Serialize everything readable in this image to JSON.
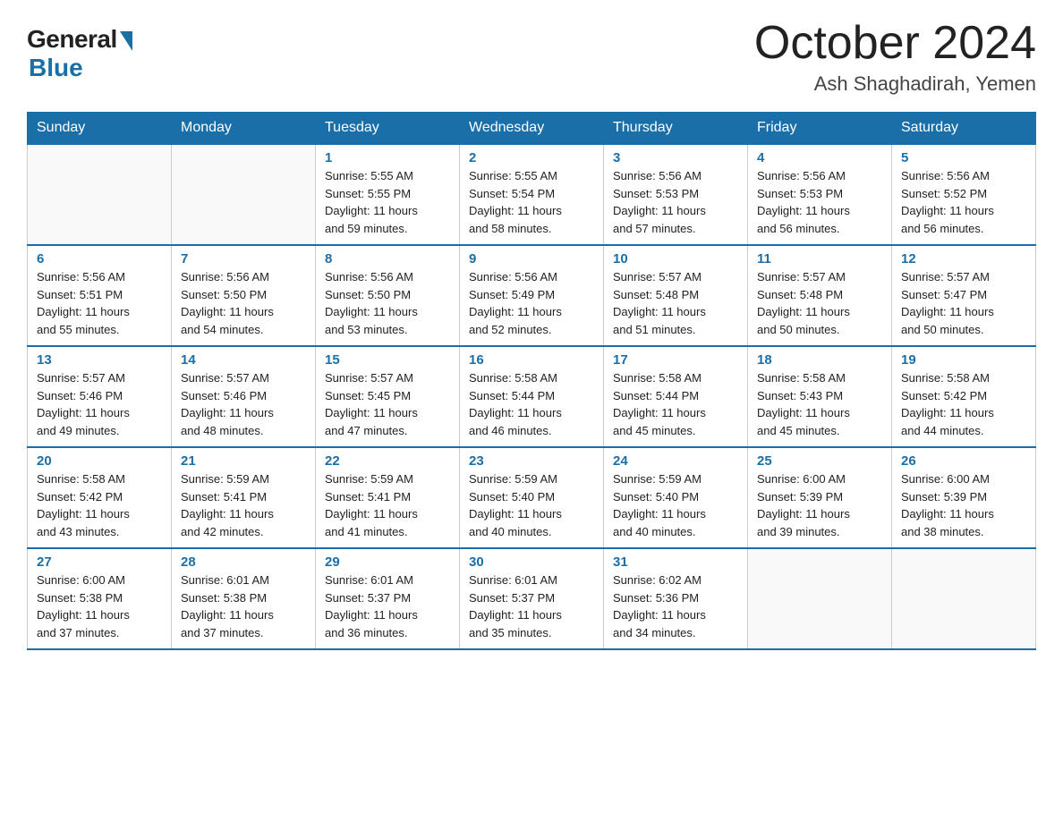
{
  "logo": {
    "general": "General",
    "blue": "Blue"
  },
  "title": "October 2024",
  "location": "Ash Shaghadirah, Yemen",
  "days_header": [
    "Sunday",
    "Monday",
    "Tuesday",
    "Wednesday",
    "Thursday",
    "Friday",
    "Saturday"
  ],
  "weeks": [
    [
      {
        "day": "",
        "info": ""
      },
      {
        "day": "",
        "info": ""
      },
      {
        "day": "1",
        "info": "Sunrise: 5:55 AM\nSunset: 5:55 PM\nDaylight: 11 hours\nand 59 minutes."
      },
      {
        "day": "2",
        "info": "Sunrise: 5:55 AM\nSunset: 5:54 PM\nDaylight: 11 hours\nand 58 minutes."
      },
      {
        "day": "3",
        "info": "Sunrise: 5:56 AM\nSunset: 5:53 PM\nDaylight: 11 hours\nand 57 minutes."
      },
      {
        "day": "4",
        "info": "Sunrise: 5:56 AM\nSunset: 5:53 PM\nDaylight: 11 hours\nand 56 minutes."
      },
      {
        "day": "5",
        "info": "Sunrise: 5:56 AM\nSunset: 5:52 PM\nDaylight: 11 hours\nand 56 minutes."
      }
    ],
    [
      {
        "day": "6",
        "info": "Sunrise: 5:56 AM\nSunset: 5:51 PM\nDaylight: 11 hours\nand 55 minutes."
      },
      {
        "day": "7",
        "info": "Sunrise: 5:56 AM\nSunset: 5:50 PM\nDaylight: 11 hours\nand 54 minutes."
      },
      {
        "day": "8",
        "info": "Sunrise: 5:56 AM\nSunset: 5:50 PM\nDaylight: 11 hours\nand 53 minutes."
      },
      {
        "day": "9",
        "info": "Sunrise: 5:56 AM\nSunset: 5:49 PM\nDaylight: 11 hours\nand 52 minutes."
      },
      {
        "day": "10",
        "info": "Sunrise: 5:57 AM\nSunset: 5:48 PM\nDaylight: 11 hours\nand 51 minutes."
      },
      {
        "day": "11",
        "info": "Sunrise: 5:57 AM\nSunset: 5:48 PM\nDaylight: 11 hours\nand 50 minutes."
      },
      {
        "day": "12",
        "info": "Sunrise: 5:57 AM\nSunset: 5:47 PM\nDaylight: 11 hours\nand 50 minutes."
      }
    ],
    [
      {
        "day": "13",
        "info": "Sunrise: 5:57 AM\nSunset: 5:46 PM\nDaylight: 11 hours\nand 49 minutes."
      },
      {
        "day": "14",
        "info": "Sunrise: 5:57 AM\nSunset: 5:46 PM\nDaylight: 11 hours\nand 48 minutes."
      },
      {
        "day": "15",
        "info": "Sunrise: 5:57 AM\nSunset: 5:45 PM\nDaylight: 11 hours\nand 47 minutes."
      },
      {
        "day": "16",
        "info": "Sunrise: 5:58 AM\nSunset: 5:44 PM\nDaylight: 11 hours\nand 46 minutes."
      },
      {
        "day": "17",
        "info": "Sunrise: 5:58 AM\nSunset: 5:44 PM\nDaylight: 11 hours\nand 45 minutes."
      },
      {
        "day": "18",
        "info": "Sunrise: 5:58 AM\nSunset: 5:43 PM\nDaylight: 11 hours\nand 45 minutes."
      },
      {
        "day": "19",
        "info": "Sunrise: 5:58 AM\nSunset: 5:42 PM\nDaylight: 11 hours\nand 44 minutes."
      }
    ],
    [
      {
        "day": "20",
        "info": "Sunrise: 5:58 AM\nSunset: 5:42 PM\nDaylight: 11 hours\nand 43 minutes."
      },
      {
        "day": "21",
        "info": "Sunrise: 5:59 AM\nSunset: 5:41 PM\nDaylight: 11 hours\nand 42 minutes."
      },
      {
        "day": "22",
        "info": "Sunrise: 5:59 AM\nSunset: 5:41 PM\nDaylight: 11 hours\nand 41 minutes."
      },
      {
        "day": "23",
        "info": "Sunrise: 5:59 AM\nSunset: 5:40 PM\nDaylight: 11 hours\nand 40 minutes."
      },
      {
        "day": "24",
        "info": "Sunrise: 5:59 AM\nSunset: 5:40 PM\nDaylight: 11 hours\nand 40 minutes."
      },
      {
        "day": "25",
        "info": "Sunrise: 6:00 AM\nSunset: 5:39 PM\nDaylight: 11 hours\nand 39 minutes."
      },
      {
        "day": "26",
        "info": "Sunrise: 6:00 AM\nSunset: 5:39 PM\nDaylight: 11 hours\nand 38 minutes."
      }
    ],
    [
      {
        "day": "27",
        "info": "Sunrise: 6:00 AM\nSunset: 5:38 PM\nDaylight: 11 hours\nand 37 minutes."
      },
      {
        "day": "28",
        "info": "Sunrise: 6:01 AM\nSunset: 5:38 PM\nDaylight: 11 hours\nand 37 minutes."
      },
      {
        "day": "29",
        "info": "Sunrise: 6:01 AM\nSunset: 5:37 PM\nDaylight: 11 hours\nand 36 minutes."
      },
      {
        "day": "30",
        "info": "Sunrise: 6:01 AM\nSunset: 5:37 PM\nDaylight: 11 hours\nand 35 minutes."
      },
      {
        "day": "31",
        "info": "Sunrise: 6:02 AM\nSunset: 5:36 PM\nDaylight: 11 hours\nand 34 minutes."
      },
      {
        "day": "",
        "info": ""
      },
      {
        "day": "",
        "info": ""
      }
    ]
  ]
}
